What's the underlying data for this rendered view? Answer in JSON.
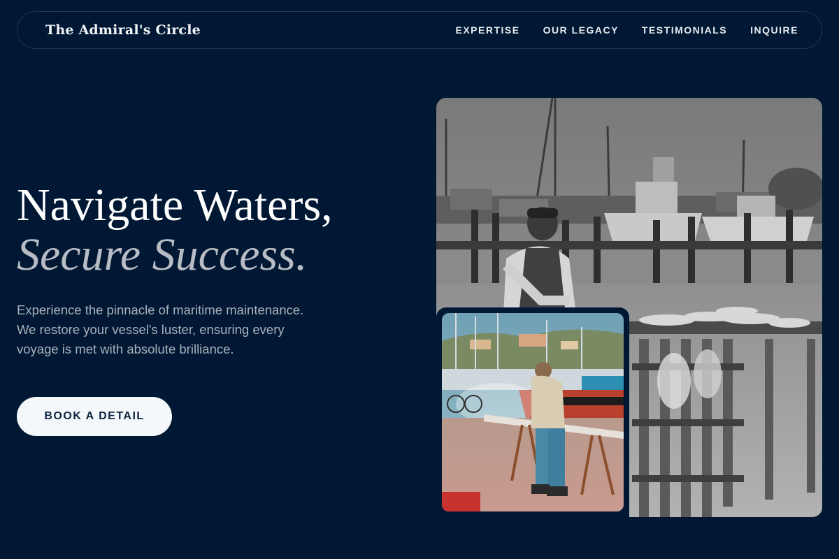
{
  "brand": {
    "name": "The Admiral's Circle"
  },
  "nav": {
    "links": [
      "EXPERTISE",
      "OUR LEGACY",
      "TESTIMONIALS",
      "INQUIRE"
    ]
  },
  "hero": {
    "headline_line1": "Navigate Waters,",
    "headline_line2": "Secure Success.",
    "lead": "Experience the pinnacle of maritime maintenance. We restore your vessel's luster, ensuring every voyage is met with absolute brilliance.",
    "cta_label": "BOOK A DETAIL"
  },
  "photos": {
    "main_subject": "fisherman-cleaning-fish-at-marina",
    "inset_subject": "worker-sanding-boat-hull"
  },
  "colors": {
    "background": "#001833",
    "nav_border": "#22344f",
    "headline": "#ffffff",
    "headline_italic": "#b8bcc4",
    "lead_text": "#a9b1bd",
    "cta_bg": "#f5f8fb",
    "cta_text": "#0c2340"
  }
}
